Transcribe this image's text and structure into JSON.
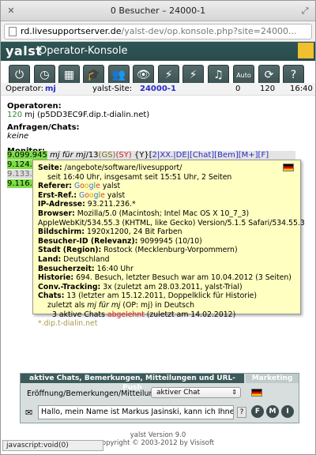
{
  "window": {
    "title": "0 Besucher – 24000-1"
  },
  "url": {
    "domain": "rd.livesupportserver.de",
    "path": "/yalst-dev/op.konsole.php?site=24000..."
  },
  "header": {
    "logo": "yalst",
    "title": "Operator-Konsole"
  },
  "toolbar": [
    {
      "icon": "power-icon",
      "glyph": "⏻"
    },
    {
      "icon": "clock-icon",
      "glyph": "◷"
    },
    {
      "icon": "stats-icon",
      "glyph": "▦"
    },
    {
      "icon": "graduation-cap-icon",
      "glyph": "🎓"
    },
    {
      "icon": "users-icon",
      "glyph": "👥"
    },
    {
      "icon": "eye-icon",
      "glyph": "👁"
    },
    {
      "icon": "plug-icon",
      "glyph": "⚡"
    },
    {
      "icon": "no-plug-icon",
      "glyph": "⚡"
    },
    {
      "icon": "music-icon",
      "glyph": "♫"
    },
    {
      "icon": "auto-icon",
      "glyph": "Auto"
    },
    {
      "icon": "refresh-icon",
      "glyph": "⟳"
    },
    {
      "icon": "help-icon",
      "glyph": "?"
    }
  ],
  "infobar": {
    "operator_label": "Operator:",
    "operator": "mj",
    "site_label": "yalst-Site:",
    "site": "24000-1",
    "count": "0",
    "value": "120",
    "time": "16:40"
  },
  "operators": {
    "title": "Operatoren:",
    "count": "120",
    "entry": "mj (p5DD3EC9F.dip.t-dialin.net)"
  },
  "requests": {
    "title": "Anfragen/Chats:",
    "value": "keine"
  },
  "monitor": {
    "title": "Monitor:",
    "rows": [
      {
        "ip": "9.099.945",
        "rest_a": " mj für mj",
        "rest_b": "/13",
        "rest_c": "(GS)",
        "rest_d": "(SY)",
        "rest_e": " {Y}[",
        "links": "2|XX.|DE|[Chat][Bem][M+][F]"
      },
      {
        "ip": "9.124.2"
      },
      {
        "ip": "9.133.2"
      },
      {
        "ip": "9.116.2"
      }
    ]
  },
  "popup": {
    "seite_label": "Seite:",
    "seite": "/angebote/software/livesupport/",
    "seite2": "seit 16:40 Uhr, insgesamt seit 15:51 Uhr, 2 Seiten",
    "referer_label": "Referer:",
    "referer_g": "Google",
    "referer": "yalst",
    "erstref_label": "Erst-Ref.:",
    "erstref_g": "Google",
    "erstref": "yalst",
    "ip_label": "IP-Adresse:",
    "ip": "93.211.236.*",
    "browser_label": "Browser:",
    "browser": "Mozilla/5.0 (Macintosh; Intel Mac OS X 10_7_3)",
    "browser2": "AppleWebKit/534.55.3 (KHTML, like Gecko) Version/5.1.5 Safari/534.55.3",
    "screen_label": "Bildschirm:",
    "screen": "1920x1200, 24 Bit Farben",
    "visitorid_label": "Besucher-ID (Relevanz):",
    "visitorid": "9099945 (10/10)",
    "city_label": "Stadt (Region):",
    "city": "Rostock (Mecklenburg-Vorpommern)",
    "country_label": "Land:",
    "country": "Deutschland",
    "start_label": "Besucherzeit:",
    "start": "16:40 Uhr",
    "history_label": "Historie:",
    "history": "694. Besuch, letzter Besuch war am 10.04.2012 (3 Seiten)",
    "conv_label": "Conv.-Tracking:",
    "conv": "3x (zuletzt am 28.03.2011, yalst-Trial)",
    "chats_label": "Chats:",
    "chats": "13 (letzter am 15.12.2011, Doppelklick für Historie)",
    "chats2_pre": "zuletzt als ",
    "chats2_name": "mj für mj",
    "chats2_post": " (OP: mj) in Deutsch",
    "chats3_pre": "3 aktive Chats ",
    "chats3_red": "abgelehnt",
    "chats3_post": " (zuletzt am 14.02.2012)",
    "host": "*.dip.t-dialin.net"
  },
  "panel": {
    "tab_active": "aktive Chats, Bemerkungen, Mitteilungen und URL-Push",
    "tab_marketing": "Marketing",
    "row_label": "Eröffnung/Bemerkungen/Mitteilung:",
    "select_value": "aktiver Chat",
    "message": "Hallo, mein Name ist Markus Jasinski, kann ich Ihnen",
    "help": "?",
    "btn_f": "F",
    "btn_m": "M",
    "btn_i": "I"
  },
  "footer": {
    "line1": "yalst Version 9.0",
    "line2": "opyright © 2003-2012 by Visisoft"
  },
  "status": {
    "text": "javascript:void(0)"
  }
}
